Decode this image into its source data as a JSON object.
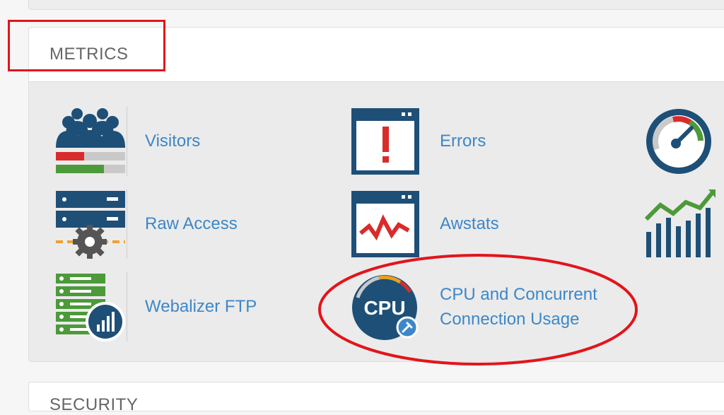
{
  "metrics": {
    "title": "METRICS",
    "items": [
      {
        "label": "Visitors",
        "icon": "visitors-icon"
      },
      {
        "label": "Errors",
        "icon": "errors-icon"
      },
      {
        "label": "Raw Access",
        "icon": "raw-access-icon"
      },
      {
        "label": "Awstats",
        "icon": "awstats-icon"
      },
      {
        "label": "Webalizer FTP",
        "icon": "webalizer-ftp-icon"
      },
      {
        "label_line1": "CPU and Concurrent",
        "label_line2": "Connection Usage",
        "icon": "cpu-icon",
        "icon_text": "CPU"
      }
    ],
    "partial_icons": [
      "bandwidth-gauge-icon",
      "analytics-chart-icon"
    ]
  },
  "security": {
    "title": "SECURITY"
  },
  "colors": {
    "link": "#3d87c8",
    "icon_dark": "#1e4f77",
    "icon_red": "#d92b2b",
    "icon_green": "#4c9a3a",
    "annotation": "#e3141b"
  }
}
